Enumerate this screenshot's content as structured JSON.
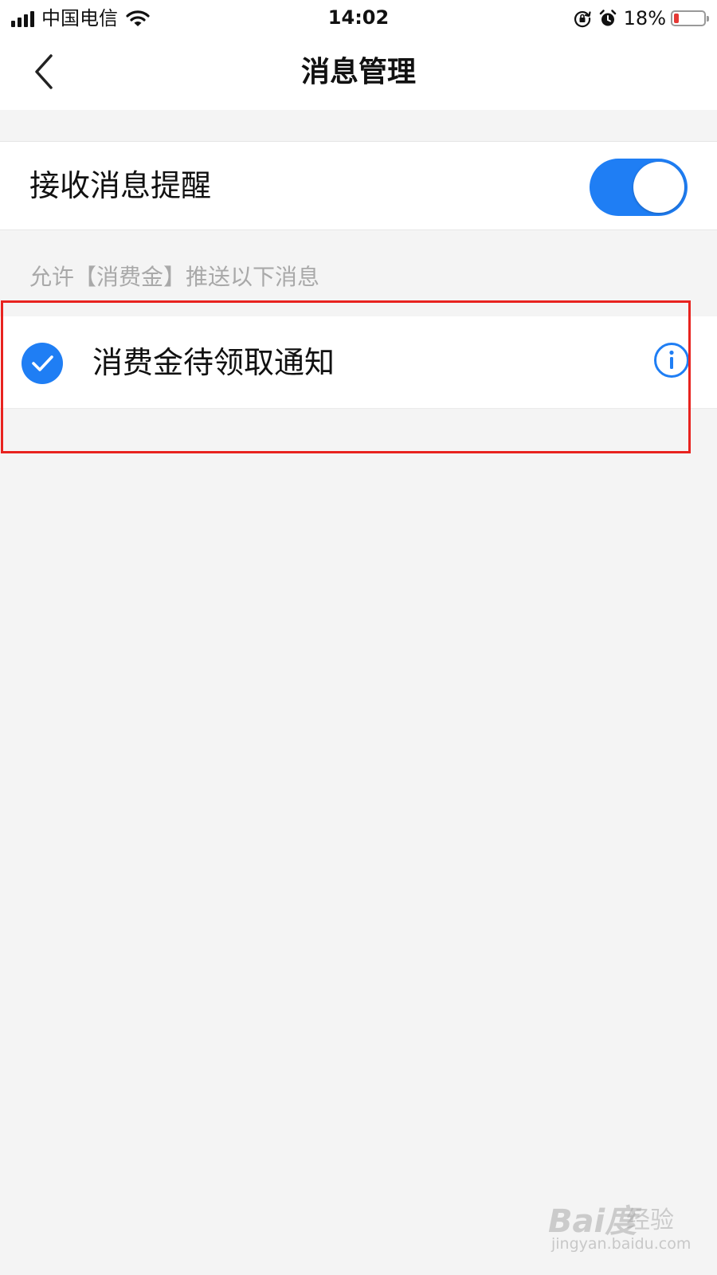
{
  "status_bar": {
    "carrier": "中国电信",
    "time": "14:02",
    "battery_percent": "18%",
    "battery_level": 0.18,
    "icons": [
      "signal-icon",
      "wifi-icon",
      "orientation-lock-icon",
      "alarm-icon",
      "battery-icon"
    ]
  },
  "nav": {
    "title": "消息管理",
    "back_icon": "chevron-left-icon"
  },
  "receive_setting": {
    "label": "接收消息提醒",
    "enabled": true
  },
  "section": {
    "hint": "允许【消费金】推送以下消息"
  },
  "message_types": [
    {
      "label": "消费金待领取通知",
      "checked": true,
      "info_icon": "info-icon"
    }
  ],
  "colors": {
    "accent": "#1f7ef4",
    "highlight": "#e8231f",
    "background": "#f4f4f4",
    "hint_text": "#a9a9a9"
  },
  "watermark": {
    "brand": "Bai度",
    "product": "经验",
    "url": "jingyan.baidu.com"
  }
}
